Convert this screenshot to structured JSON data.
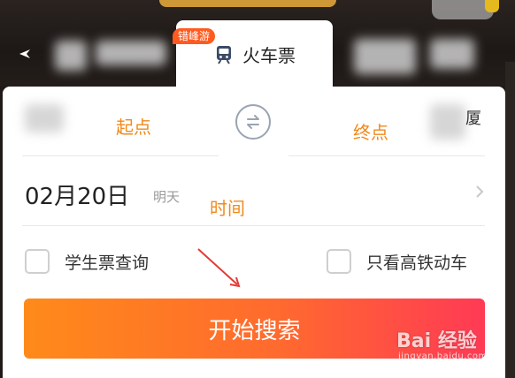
{
  "tabs": {
    "active_label": "火车票",
    "badge": "错峰游"
  },
  "route": {
    "from_hint": "起点",
    "to_hint": "终点",
    "to_city_edge": "厦"
  },
  "date": {
    "value": "02月20日",
    "weekday": "明天",
    "hint": "时间"
  },
  "options": {
    "student_label": "学生票查询",
    "highspeed_label": "只看高铁动车"
  },
  "search": {
    "button_label": "开始搜索"
  },
  "watermark": {
    "logo": "Bai 经验",
    "sub": "jingyan.baidu.com"
  },
  "colors": {
    "accent_orange": "#ff8a1a",
    "accent_red": "#ff3a55",
    "hint_orange": "#f08a1c",
    "badge": "#ff5a1f"
  },
  "icons": [
    "train-icon",
    "swap-icon",
    "chevron-right-icon",
    "arrow-icon"
  ]
}
